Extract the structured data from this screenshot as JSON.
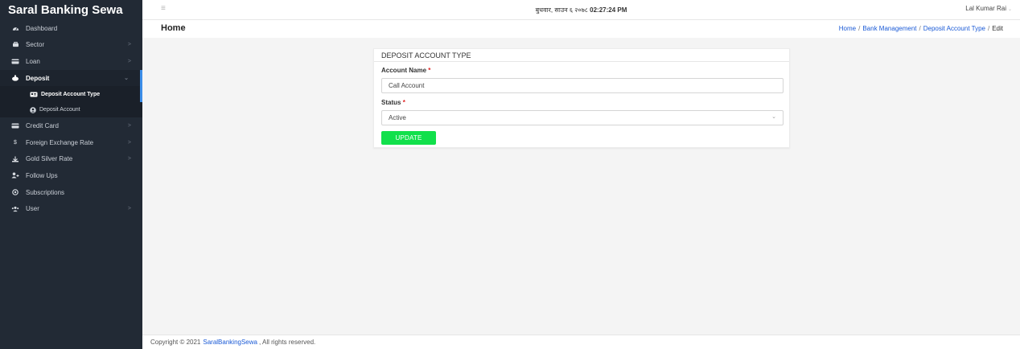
{
  "sidebar": {
    "brand": "Saral Banking Sewa",
    "items": [
      {
        "label": "Dashboard",
        "icon": "dashboard-icon",
        "chevron": ""
      },
      {
        "label": "Sector",
        "icon": "sector-icon",
        "chevron": ">"
      },
      {
        "label": "Loan",
        "icon": "loan-icon",
        "chevron": ">"
      },
      {
        "label": "Deposit",
        "icon": "deposit-icon",
        "chevron": "⌄"
      },
      {
        "label": "Credit Card",
        "icon": "credit-card-icon",
        "chevron": ">"
      },
      {
        "label": "Foreign Exchange Rate",
        "icon": "dollar-icon",
        "chevron": ">"
      },
      {
        "label": "Gold Silver Rate",
        "icon": "gold-silver-icon",
        "chevron": ">"
      },
      {
        "label": "Follow Ups",
        "icon": "user-plus-icon",
        "chevron": ""
      },
      {
        "label": "Subscriptions",
        "icon": "subscriptions-icon",
        "chevron": ""
      },
      {
        "label": "User",
        "icon": "users-icon",
        "chevron": ">"
      }
    ],
    "deposit_submenu": [
      {
        "label": "Deposit Account Type",
        "icon": "id-card-icon"
      },
      {
        "label": "Deposit Account",
        "icon": "user-circle-icon"
      }
    ]
  },
  "topbar": {
    "date": "बुधवार, साउन ६ २०७८",
    "time": "02:27:24 PM",
    "user": "Lal Kumar Rai"
  },
  "page": {
    "title": "Home",
    "breadcrumb": [
      "Home",
      "Bank Management",
      "Deposit Account Type",
      "Edit"
    ]
  },
  "form": {
    "card_title": "DEPOSIT ACCOUNT TYPE",
    "account_name_label": "Account Name",
    "account_name_value": "Call Account",
    "status_label": "Status",
    "status_value": "Active",
    "required_mark": "*",
    "submit_label": "UPDATE"
  },
  "footer": {
    "prefix": "Copyright © 2021",
    "link": "SaralBankingSewa",
    "suffix": ", All rights reserved."
  },
  "colors": {
    "sidebar_bg": "#222a35",
    "accent": "#3b8de8",
    "update_button": "#11e04b",
    "link": "#1a5ad6",
    "required": "#e02424"
  }
}
